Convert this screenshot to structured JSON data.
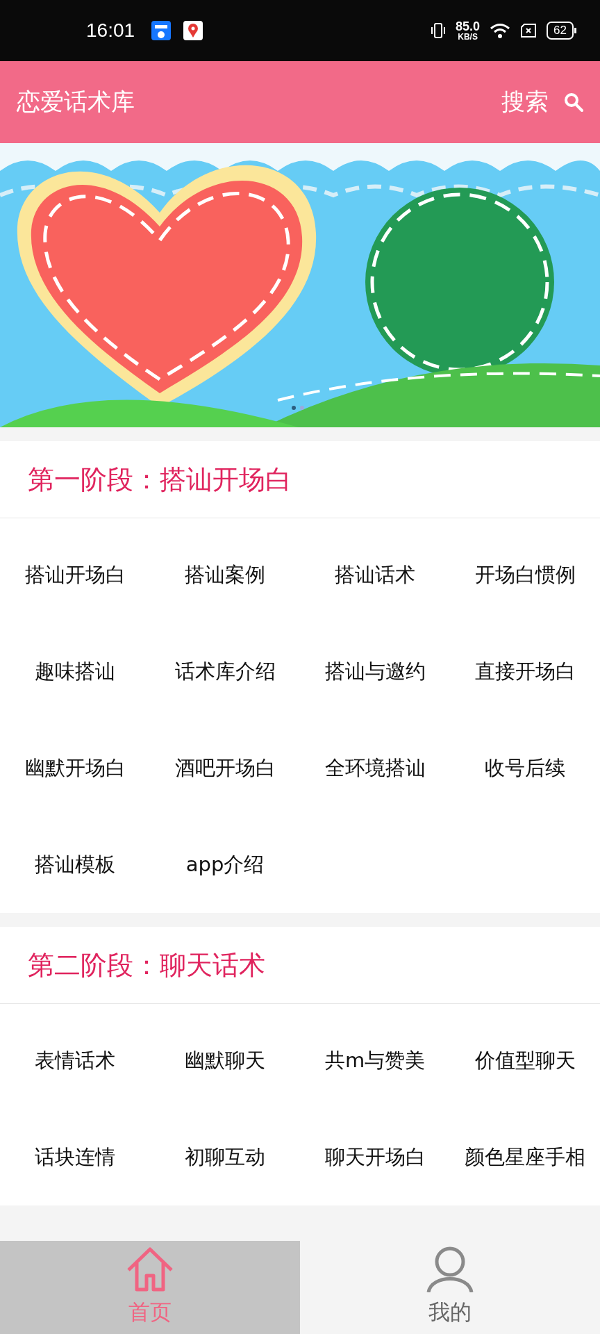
{
  "status_bar": {
    "time": "16:01",
    "speed": "85.0",
    "speed_unit": "KB/S",
    "battery": "62"
  },
  "header": {
    "title": "恋爱话术库",
    "search_label": "搜索"
  },
  "banner": {
    "kind": "picture",
    "dots": [
      {
        "selected": true
      },
      {
        "selected": false
      }
    ]
  },
  "sections": [
    {
      "title": "第一阶段：搭讪开场白",
      "items": [
        "搭讪开场白",
        "搭讪案例",
        "搭讪话术",
        "开场白惯例",
        "趣味搭讪",
        "话术库介绍",
        "搭讪与邀约",
        "直接开场白",
        "幽默开场白",
        "酒吧开场白",
        "全环境搭讪",
        "收号后续",
        "搭讪模板",
        "app介绍"
      ]
    },
    {
      "title": "第二阶段：聊天话术",
      "items": [
        "表情话术",
        "幽默聊天",
        "共m与赞美",
        "价值型聊天",
        "话块连情",
        "初聊互动",
        "聊天开场白",
        "颜色星座手相"
      ]
    }
  ],
  "tabs": [
    {
      "label": "首页",
      "selected": true
    },
    {
      "label": "我的",
      "selected": false
    }
  ]
}
